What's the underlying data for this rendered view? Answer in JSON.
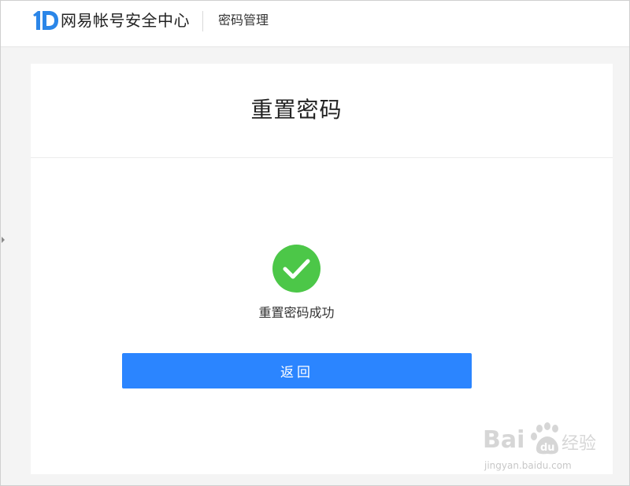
{
  "header": {
    "brand_text": "网易帐号安全中心",
    "section_title": "密码管理"
  },
  "card": {
    "title": "重置密码",
    "success_message": "重置密码成功",
    "back_button_label": "返回"
  },
  "watermark": {
    "logo_text": "Baidu经验",
    "url": "jingyan.baidu.com"
  },
  "icons": {
    "brand_logo": "netease-id-logo-icon",
    "success": "check-circle-icon"
  },
  "colors": {
    "primary_button": "#2b85ff",
    "success_green": "#4cc748",
    "brand_blue": "#2b86e8",
    "page_background": "#f4f4f4"
  }
}
